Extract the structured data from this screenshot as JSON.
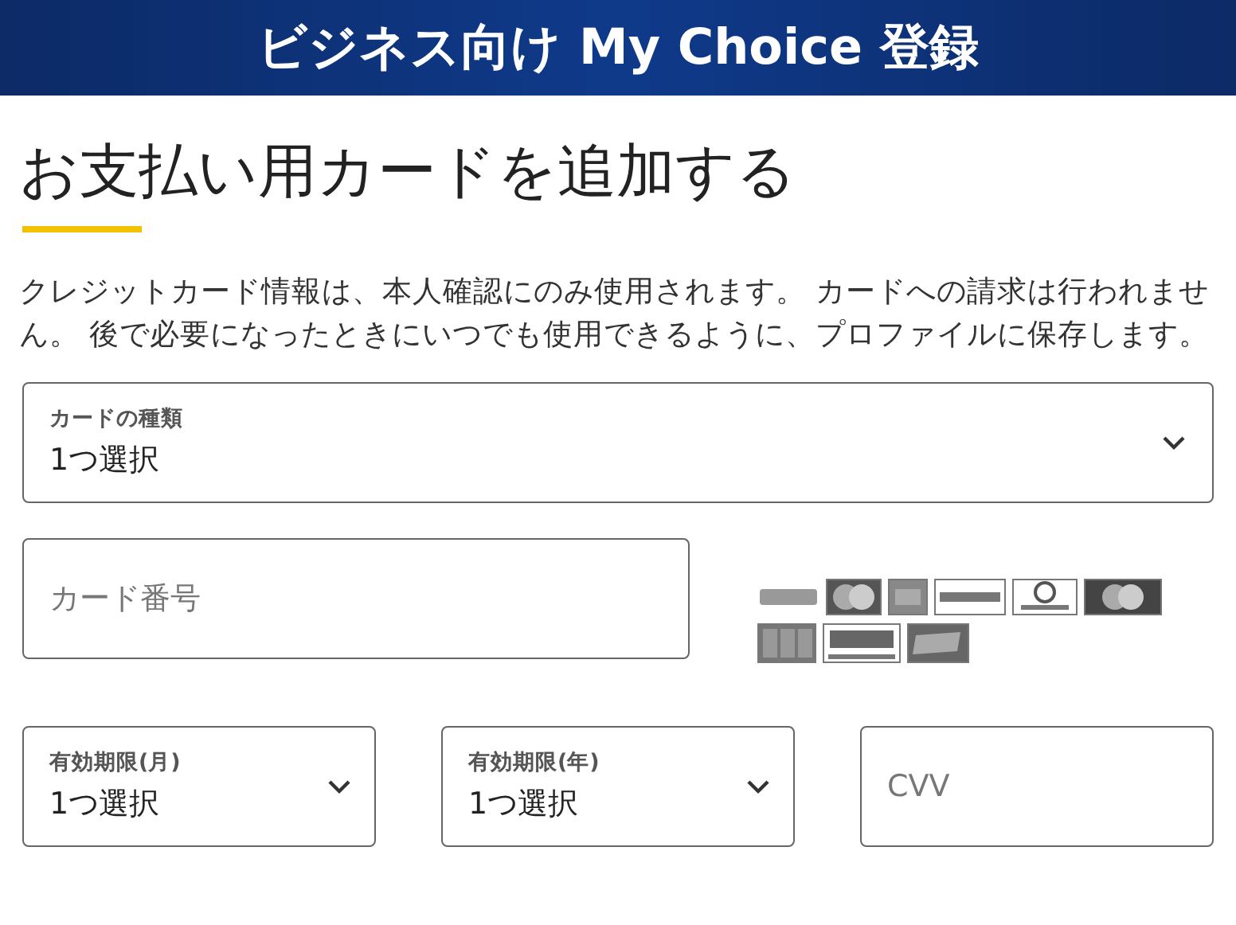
{
  "header": {
    "title": "ビジネス向け My Choice 登録"
  },
  "heading": "お支払い用カードを追加する",
  "description": "クレジットカード情報は、本人確認にのみ使用されます。 カードへの請求は行われません。 後で必要になったときにいつでも使用できるように、プロファイルに保存します。",
  "card_type": {
    "kind": "select",
    "label": "カードの種類",
    "value": "1つ選択"
  },
  "card_number": {
    "placeholder": "カード番号"
  },
  "expiry_row": [
    {
      "kind": "select",
      "label": "有効期限(月)",
      "value": "1つ選択"
    },
    {
      "kind": "select",
      "label": "有効期限(年)",
      "value": "1つ選択"
    },
    {
      "kind": "input",
      "placeholder": "CVV"
    }
  ]
}
